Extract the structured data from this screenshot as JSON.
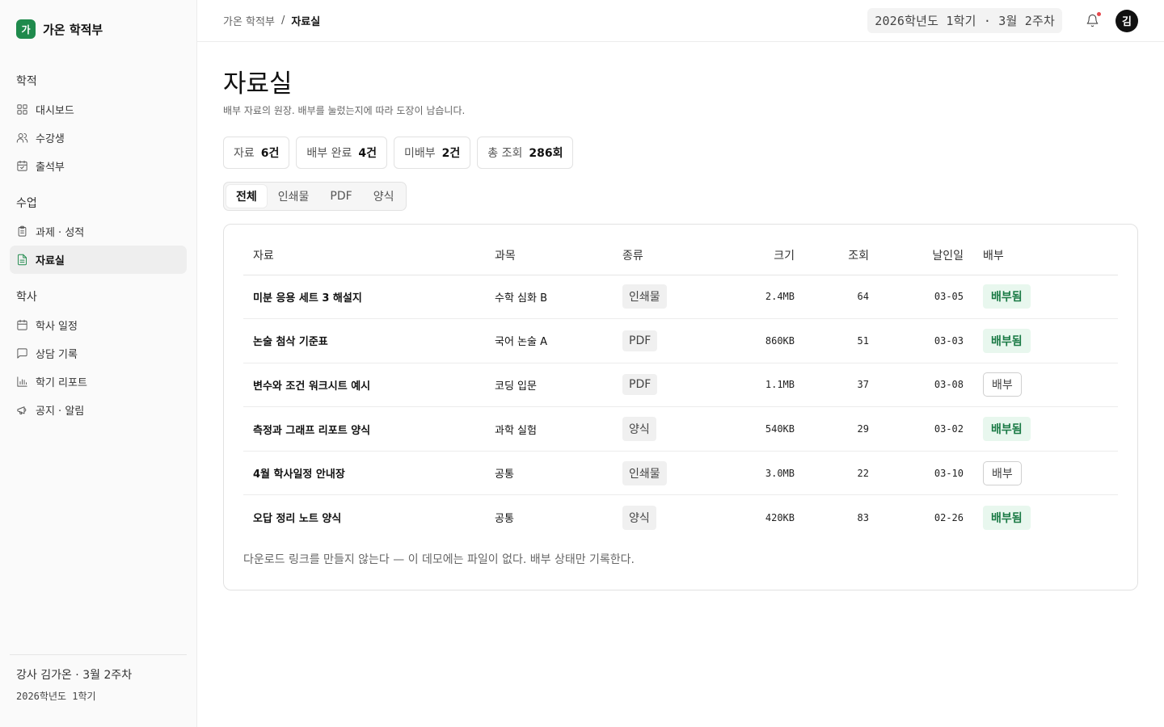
{
  "brand": {
    "logo_char": "가",
    "name": "가온 학적부"
  },
  "nav": {
    "sections": [
      {
        "title": "학적",
        "items": [
          {
            "label": "대시보드",
            "icon": "grid-icon"
          },
          {
            "label": "수강생",
            "icon": "users-icon"
          },
          {
            "label": "출석부",
            "icon": "calendar-check-icon"
          }
        ]
      },
      {
        "title": "수업",
        "items": [
          {
            "label": "과제 · 성적",
            "icon": "clipboard-icon"
          },
          {
            "label": "자료실",
            "icon": "file-text-icon",
            "active": true
          }
        ]
      },
      {
        "title": "학사",
        "items": [
          {
            "label": "학사 일정",
            "icon": "calendar-icon"
          },
          {
            "label": "상담 기록",
            "icon": "message-icon"
          },
          {
            "label": "학기 리포트",
            "icon": "bar-chart-icon"
          },
          {
            "label": "공지 · 알림",
            "icon": "megaphone-icon"
          }
        ]
      }
    ]
  },
  "sidebar_footer": {
    "line1": "강사 김가온 · 3월 2주차",
    "line2": "2026학년도 1학기"
  },
  "topbar": {
    "breadcrumb_root": "가온 학적부",
    "breadcrumb_sep": "/",
    "breadcrumb_current": "자료실",
    "term": "2026학년도 1학기 · 3월 2주차",
    "avatar": "김"
  },
  "page": {
    "title": "자료실",
    "subtitle": "배부 자료의 원장. 배부를 눌렀는지에 따라 도장이 남습니다."
  },
  "stats": [
    {
      "label": "자료",
      "value": "6건"
    },
    {
      "label": "배부 완료",
      "value": "4건"
    },
    {
      "label": "미배부",
      "value": "2건"
    },
    {
      "label": "총 조회",
      "value": "286회"
    }
  ],
  "tabs": [
    {
      "label": "전체",
      "active": true
    },
    {
      "label": "인쇄물"
    },
    {
      "label": "PDF"
    },
    {
      "label": "양식"
    }
  ],
  "table": {
    "headers": {
      "name": "자료",
      "subject": "과목",
      "type": "종류",
      "size": "크기",
      "views": "조회",
      "date": "날인일",
      "status": "배부"
    },
    "rows": [
      {
        "name": "미분 응용 세트 3 해설지",
        "subject": "수학 심화 B",
        "type": "인쇄물",
        "size": "2.4MB",
        "views": "64",
        "date": "03-05",
        "status": "배부됨",
        "distributed": true
      },
      {
        "name": "논술 첨삭 기준표",
        "subject": "국어 논술 A",
        "type": "PDF",
        "size": "860KB",
        "views": "51",
        "date": "03-03",
        "status": "배부됨",
        "distributed": true
      },
      {
        "name": "변수와 조건 워크시트 예시",
        "subject": "코딩 입문",
        "type": "PDF",
        "size": "1.1MB",
        "views": "37",
        "date": "03-08",
        "status": "배부",
        "distributed": false
      },
      {
        "name": "측정과 그래프 리포트 양식",
        "subject": "과학 실험",
        "type": "양식",
        "size": "540KB",
        "views": "29",
        "date": "03-02",
        "status": "배부됨",
        "distributed": true
      },
      {
        "name": "4월 학사일정 안내장",
        "subject": "공통",
        "type": "인쇄물",
        "size": "3.0MB",
        "views": "22",
        "date": "03-10",
        "status": "배부",
        "distributed": false
      },
      {
        "name": "오답 정리 노트 양식",
        "subject": "공통",
        "type": "양식",
        "size": "420KB",
        "views": "83",
        "date": "02-26",
        "status": "배부됨",
        "distributed": true
      }
    ]
  },
  "note": "다운로드 링크를 만들지 않는다 — 이 데모에는 파일이 없다. 배부 상태만 기록한다.",
  "colors": {
    "accent": "#1f8a4c",
    "status_bg": "#e8f7ee",
    "status_text": "#1a7a45",
    "notification": "#e5484d"
  }
}
